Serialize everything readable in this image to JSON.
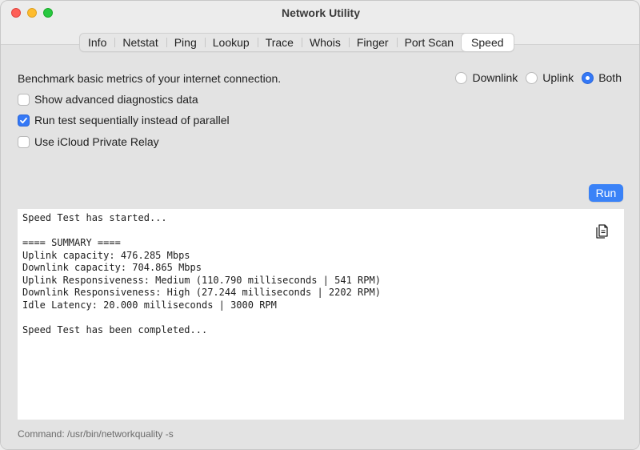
{
  "window": {
    "title": "Network Utility"
  },
  "tabs": [
    {
      "label": "Info",
      "active": false
    },
    {
      "label": "Netstat",
      "active": false
    },
    {
      "label": "Ping",
      "active": false
    },
    {
      "label": "Lookup",
      "active": false
    },
    {
      "label": "Trace",
      "active": false
    },
    {
      "label": "Whois",
      "active": false
    },
    {
      "label": "Finger",
      "active": false
    },
    {
      "label": "Port Scan",
      "active": false
    },
    {
      "label": "Speed",
      "active": true
    }
  ],
  "speed": {
    "description": "Benchmark basic metrics of your internet connection.",
    "direction": {
      "options": [
        "Downlink",
        "Uplink",
        "Both"
      ],
      "selected": "Both"
    },
    "options": [
      {
        "label": "Show advanced diagnostics data",
        "checked": false
      },
      {
        "label": "Run test sequentially instead of parallel",
        "checked": true
      },
      {
        "label": "Use iCloud Private Relay",
        "checked": false
      }
    ],
    "run_label": "Run"
  },
  "output": {
    "lines": [
      "Speed Test has started...",
      "",
      "==== SUMMARY ====",
      "Uplink capacity: 476.285 Mbps",
      "Downlink capacity: 704.865 Mbps",
      "Uplink Responsiveness: Medium (110.790 milliseconds | 541 RPM)",
      "Downlink Responsiveness: High (27.244 milliseconds | 2202 RPM)",
      "Idle Latency: 20.000 milliseconds | 3000 RPM",
      "",
      "Speed Test has been completed..."
    ],
    "copy_icon": "copy-icon"
  },
  "command": "Command: /usr/bin/networkquality -s",
  "colors": {
    "accent": "#3478f6",
    "close": "#fe5f57",
    "minimize": "#febc2e",
    "maximize": "#28c840"
  }
}
